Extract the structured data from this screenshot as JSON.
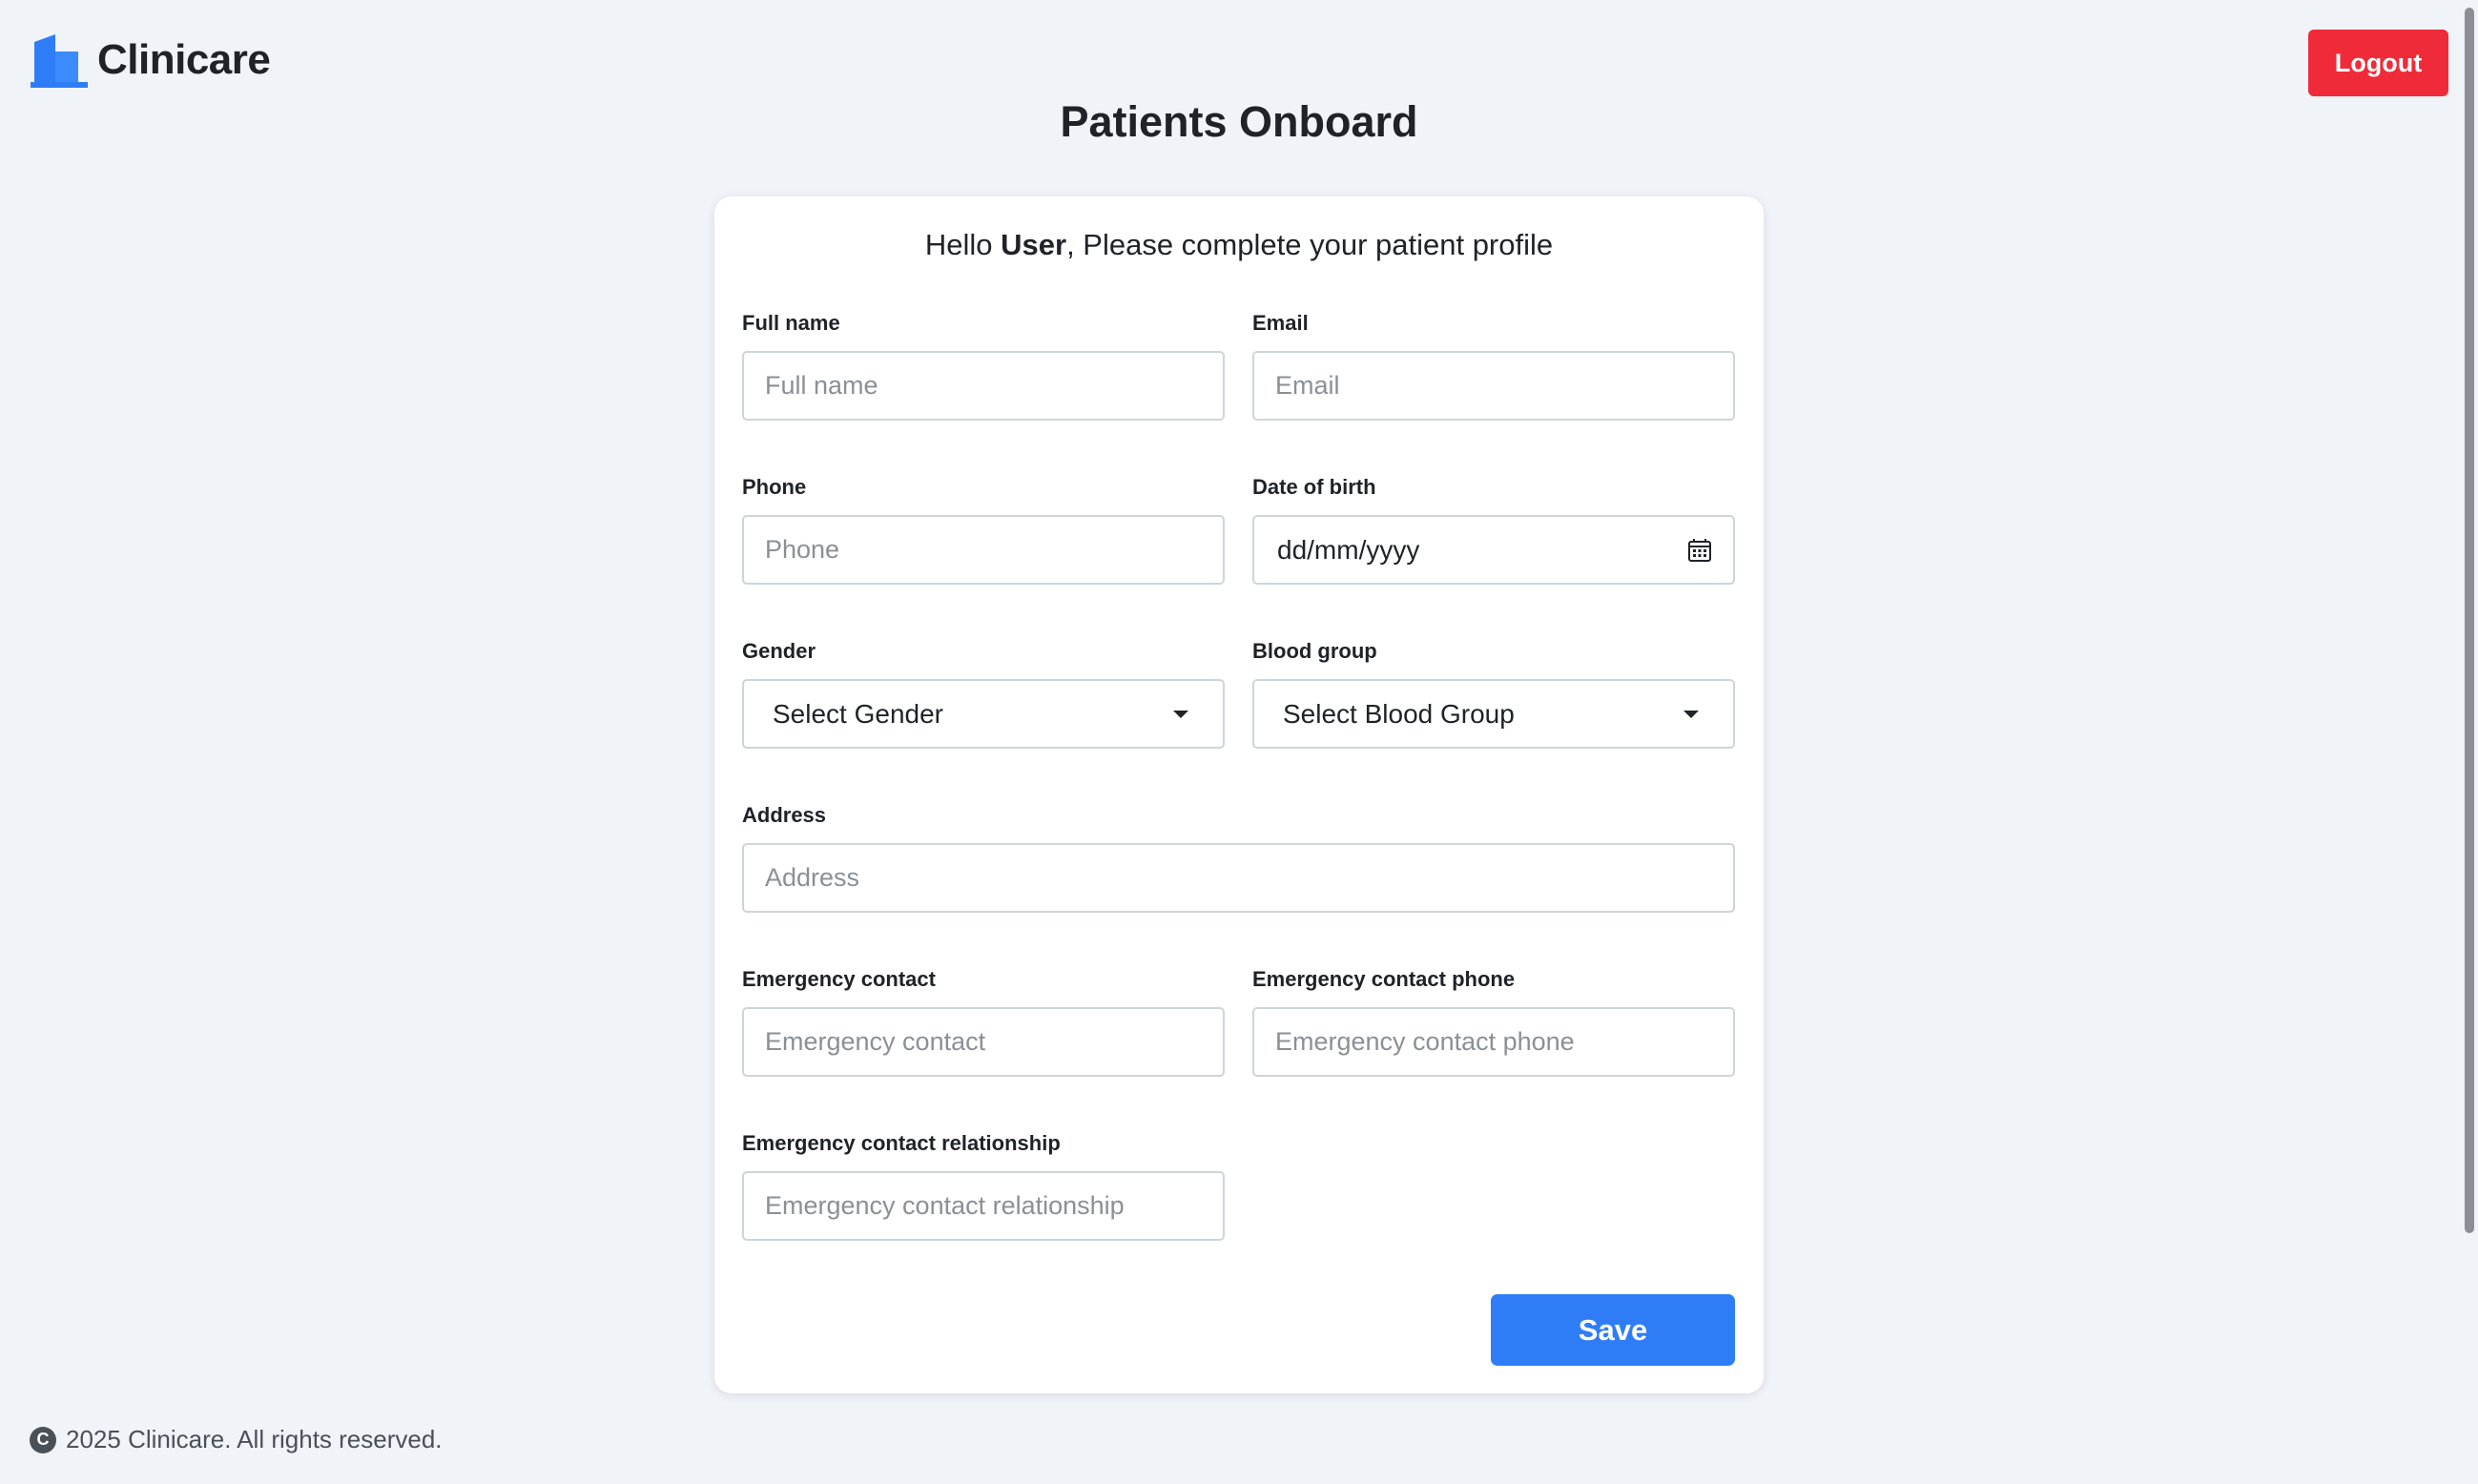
{
  "header": {
    "brand": "Clinicare",
    "logout_label": "Logout",
    "page_title": "Patients Onboard"
  },
  "form": {
    "greeting_prefix": "Hello ",
    "greeting_user": "User",
    "greeting_suffix": ", Please complete your patient profile",
    "full_name": {
      "label": "Full name",
      "placeholder": "Full name",
      "value": ""
    },
    "email": {
      "label": "Email",
      "placeholder": "Email",
      "value": ""
    },
    "phone": {
      "label": "Phone",
      "placeholder": "Phone",
      "value": ""
    },
    "dob": {
      "label": "Date of birth",
      "display": "dd/mm/yyyy"
    },
    "gender": {
      "label": "Gender",
      "selected": "Select Gender"
    },
    "blood_group": {
      "label": "Blood group",
      "selected": "Select Blood Group"
    },
    "address": {
      "label": "Address",
      "placeholder": "Address",
      "value": ""
    },
    "emergency_contact": {
      "label": "Emergency contact",
      "placeholder": "Emergency contact",
      "value": ""
    },
    "emergency_phone": {
      "label": "Emergency contact phone",
      "placeholder": "Emergency contact phone",
      "value": ""
    },
    "emergency_relationship": {
      "label": "Emergency contact relationship",
      "placeholder": "Emergency contact relationship",
      "value": ""
    },
    "save_label": "Save"
  },
  "footer": {
    "copyright_symbol": "C",
    "text": "2025 Clinicare. All rights reserved."
  },
  "colors": {
    "background": "#f0f3f8",
    "brand_blue": "#2f7df6",
    "logout_red": "#ef2b3a",
    "text": "#1f2328"
  },
  "icons": {
    "logo": "building-icon",
    "dob": "calendar-icon",
    "select": "caret-down-icon",
    "footer": "copyright-icon"
  }
}
